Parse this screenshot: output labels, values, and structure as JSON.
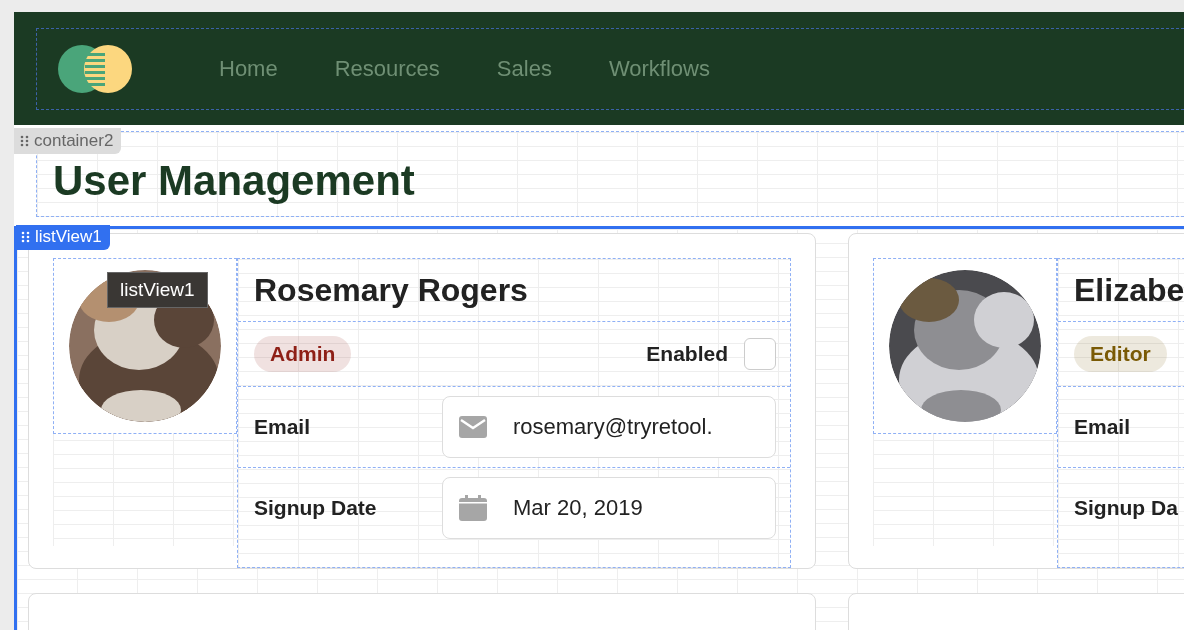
{
  "nav": {
    "items": [
      {
        "label": "Home"
      },
      {
        "label": "Resources"
      },
      {
        "label": "Sales"
      },
      {
        "label": "Workflows"
      }
    ]
  },
  "editor": {
    "container_label": "container2",
    "list_label": "listView1",
    "tooltip": "listView1"
  },
  "page_title": "User Management",
  "users": [
    {
      "name": "Rosemary Rogers",
      "role": "Admin",
      "color": "#8e1f16",
      "enabled_label": "Enabled",
      "enabled": false,
      "email_label": "Email",
      "email": "rosemary@tryretool.",
      "date_label": "Signup Date",
      "signup_date": "Mar 20, 2019"
    },
    {
      "name": "Elizabe",
      "role": "Editor",
      "color": "#7a5a05",
      "email_label": "Email",
      "date_label": "Signup Da"
    }
  ]
}
